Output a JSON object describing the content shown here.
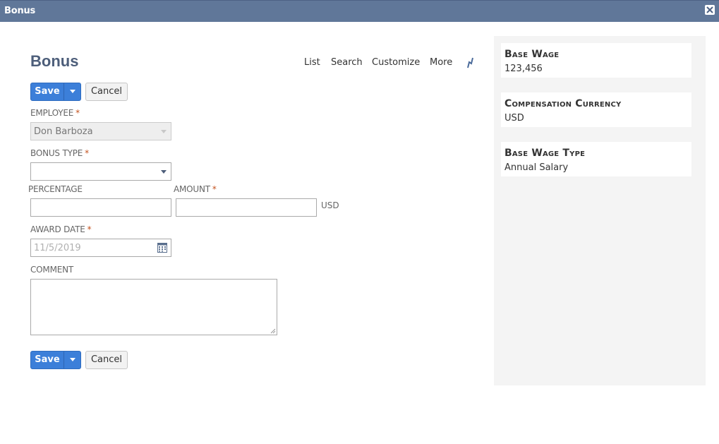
{
  "window": {
    "title": "Bonus"
  },
  "page": {
    "title": "Bonus"
  },
  "nav": {
    "list": "List",
    "search": "Search",
    "customize": "Customize",
    "more": "More"
  },
  "actions": {
    "save": "Save",
    "cancel": "Cancel"
  },
  "form": {
    "employee": {
      "label": "Employee",
      "required_mark": "*",
      "value": "Don Barboza"
    },
    "bonus_type": {
      "label": "Bonus Type",
      "required_mark": "*",
      "value": ""
    },
    "percentage": {
      "label": "Percentage",
      "value": ""
    },
    "amount": {
      "label": "Amount",
      "required_mark": "*",
      "value": "",
      "unit": "USD"
    },
    "award_date": {
      "label": "Award Date",
      "required_mark": "*",
      "placeholder": "11/5/2019"
    },
    "comment": {
      "label": "Comment",
      "value": ""
    }
  },
  "sidebar": {
    "cards": [
      {
        "title": "Base Wage",
        "value": "123,456"
      },
      {
        "title": "Compensation Currency",
        "value": "USD"
      },
      {
        "title": "Base Wage Type",
        "value": "Annual Salary"
      }
    ]
  },
  "colors": {
    "titlebar": "#607799",
    "primary_button": "#3c7fd9",
    "page_title": "#4d5e7a",
    "required": "#c4521e",
    "side_panel": "#f4f4f4"
  },
  "icons": {
    "close": "close-icon",
    "dropdown": "chevron-down-icon",
    "calendar": "calendar-icon",
    "edge": "pin-icon"
  }
}
